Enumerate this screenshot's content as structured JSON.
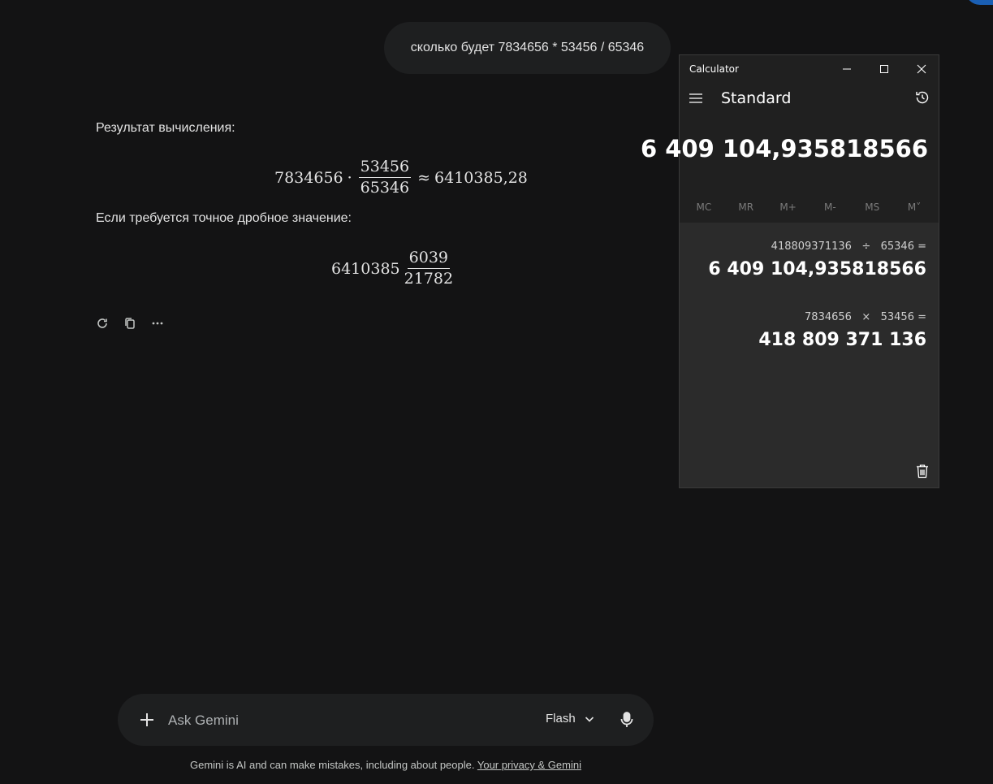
{
  "chat": {
    "user_message": "сколько будет 7834656 * 53456 / 65346",
    "response": {
      "intro": "Результат вычисления:",
      "eq1": {
        "a": "7834656",
        "dot": "·",
        "num": "53456",
        "den": "65346",
        "approx": "≈",
        "result": "6410385,28"
      },
      "exact_label": "Если требуется точное дробное значение:",
      "eq2": {
        "whole": "6410385",
        "num": "6039",
        "den": "21782"
      }
    },
    "actions": {
      "regenerate_icon": "refresh-icon",
      "copy_icon": "copy-icon",
      "more_icon": "more-horizontal-icon"
    }
  },
  "input": {
    "placeholder": "Ask Gemini",
    "model": "Flash"
  },
  "disclaimer": {
    "text": "Gemini is AI and can make mistakes, including about people. ",
    "link": "Your privacy & Gemini"
  },
  "calculator": {
    "window_title": "Calculator",
    "mode": "Standard",
    "display": "6 409 104,935818566",
    "memory_buttons": [
      "MC",
      "MR",
      "M+",
      "M-",
      "MS",
      "M˅"
    ],
    "history": [
      {
        "expression": "418809371136   ÷   65346 =",
        "result": "6 409 104,935818566"
      },
      {
        "expression": "7834656   ×   53456 =",
        "result": "418 809 371 136"
      }
    ]
  }
}
